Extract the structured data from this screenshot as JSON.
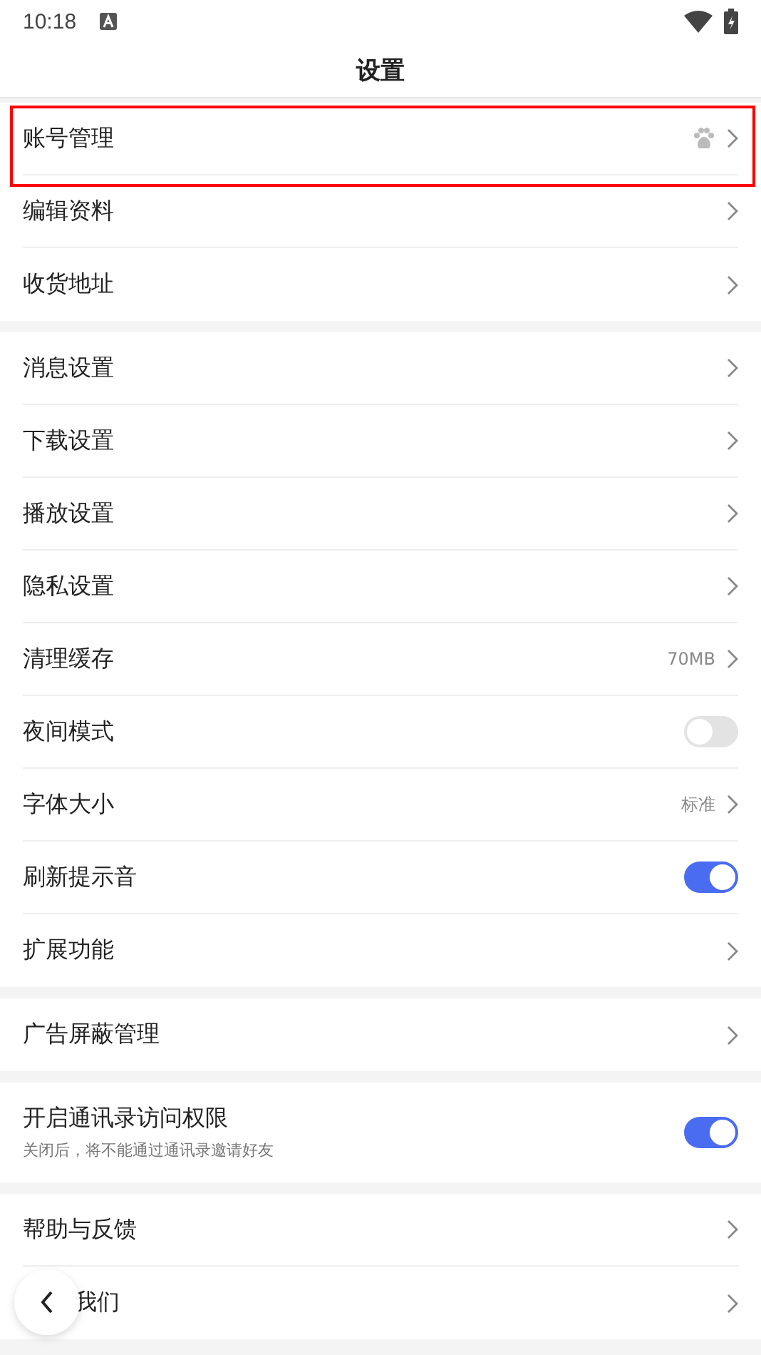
{
  "status_bar": {
    "time": "10:18"
  },
  "header": {
    "title": "设置"
  },
  "groups": [
    {
      "items": [
        {
          "kind": "link",
          "label": "账号管理",
          "badge_icon": true,
          "highlighted": true
        },
        {
          "kind": "link",
          "label": "编辑资料"
        },
        {
          "kind": "link",
          "label": "收货地址"
        }
      ]
    },
    {
      "items": [
        {
          "kind": "link",
          "label": "消息设置"
        },
        {
          "kind": "link",
          "label": "下载设置"
        },
        {
          "kind": "link",
          "label": "播放设置"
        },
        {
          "kind": "link",
          "label": "隐私设置"
        },
        {
          "kind": "link",
          "label": "清理缓存",
          "value": "70MB"
        },
        {
          "kind": "toggle",
          "label": "夜间模式",
          "on": false
        },
        {
          "kind": "link",
          "label": "字体大小",
          "value": "标准"
        },
        {
          "kind": "toggle",
          "label": "刷新提示音",
          "on": true
        },
        {
          "kind": "link",
          "label": "扩展功能"
        }
      ]
    },
    {
      "items": [
        {
          "kind": "link",
          "label": "广告屏蔽管理"
        }
      ]
    },
    {
      "items": [
        {
          "kind": "toggle",
          "label": "开启通讯录访问权限",
          "subtitle": "关闭后，将不能通过通讯录邀请好友",
          "on": true
        }
      ]
    },
    {
      "items": [
        {
          "kind": "link",
          "label": "帮助与反馈"
        },
        {
          "kind": "link",
          "label": "我们",
          "covered": true
        }
      ]
    }
  ]
}
